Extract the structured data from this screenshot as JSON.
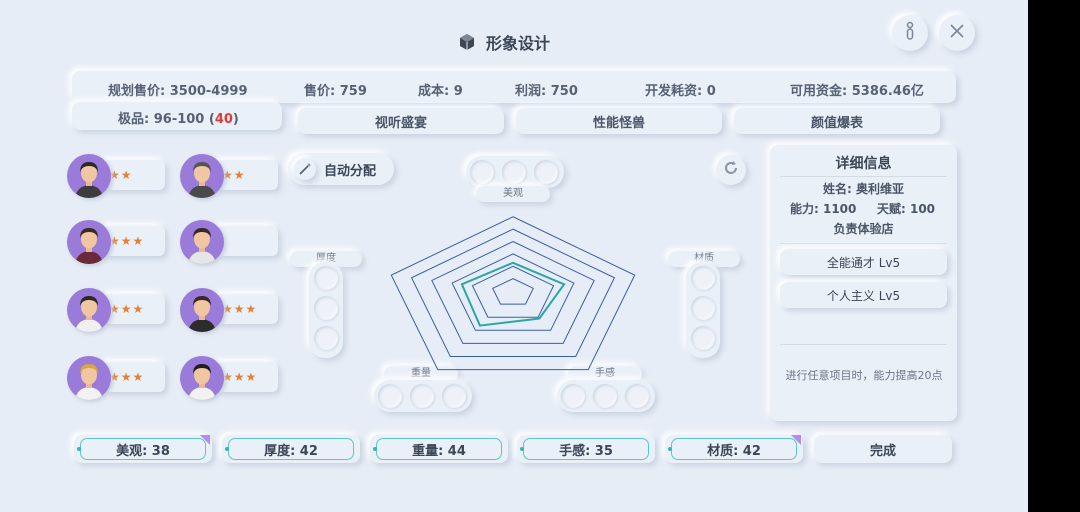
{
  "header": {
    "title": "形象设计",
    "title_icon": "cube-icon",
    "info_icon": "info-icon",
    "close_icon": "close-icon"
  },
  "stats": {
    "planned_price": "规划售价: 3500-4999",
    "price": "售价: 759",
    "cost": "成本: 9",
    "profit": "利润: 750",
    "dev_cost": "开发耗资: 0",
    "funds": "可用资金: 5386.46亿",
    "quality_label": "极品: 96-100 (",
    "quality_value": "40",
    "quality_close": ")"
  },
  "features": [
    "视听盛宴",
    "性能怪兽",
    "颜值爆表"
  ],
  "auto_assign": "自动分配",
  "staff": [
    {
      "stars": "★★",
      "hair": "#2a2a2a",
      "shirt": "#3c3c3c"
    },
    {
      "stars": "★★",
      "hair": "#555555",
      "shirt": "#4a4a4a"
    },
    {
      "stars": "★★★",
      "hair": "#3a2a22",
      "shirt": "#6a2a3a"
    },
    {
      "stars": "",
      "hair": "#3a2a22",
      "shirt": "#e6e6e6"
    },
    {
      "stars": "★★★",
      "hair": "#2a2a2a",
      "shirt": "#f0f0f0"
    },
    {
      "stars": "★★★",
      "hair": "#3a2a22",
      "shirt": "#2c2c2c"
    },
    {
      "stars": "★★★",
      "hair": "#d8a838",
      "shirt": "#f2f2f2"
    },
    {
      "stars": "★★★",
      "hair": "#1e1e1e",
      "shirt": "#f2f2f2"
    }
  ],
  "radar": {
    "axes": [
      "美观",
      "材质",
      "手感",
      "重量",
      "厚度"
    ],
    "values": [
      0.38,
      0.42,
      0.35,
      0.44,
      0.42
    ],
    "rings": 6,
    "grid_color": "#3b5ea8",
    "value_color": "#2aa7a5"
  },
  "details": {
    "title": "详细信息",
    "name": "姓名: 奥利维亚",
    "ability": "能力: 1100",
    "talent": "天赋: 100",
    "role": "负责体验店",
    "traits": [
      "全能通才  Lv5",
      "个人主义  Lv5"
    ],
    "bonus": "进行任意项目时，能力提高20点"
  },
  "bottom": {
    "metrics": [
      "美观: 38",
      "厚度: 42",
      "重量: 44",
      "手感: 35",
      "材质: 42"
    ],
    "done": "完成"
  },
  "colors": {
    "accent_teal": "#5ec6c4",
    "star": "#e0823a",
    "highlight_red": "#e03b3b",
    "avatar_bg": "#9b7bd9"
  }
}
